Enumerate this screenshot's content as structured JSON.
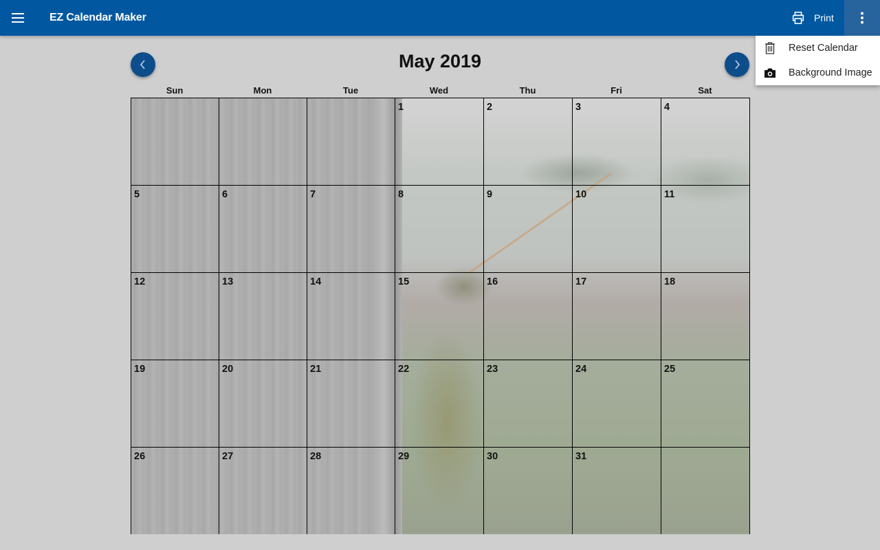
{
  "app": {
    "title": "EZ Calendar Maker",
    "icons": {
      "menu": "hamburger-menu-icon",
      "print": "printer-icon",
      "more": "more-vert-icon"
    },
    "brand_color": "#0158a1"
  },
  "toolbar": {
    "print_label": "Print"
  },
  "overflow_menu": {
    "items": [
      {
        "label": "Reset Calendar",
        "icon": "trash-icon"
      },
      {
        "label": "Background Image",
        "icon": "camera-icon"
      }
    ]
  },
  "calendar": {
    "title": "May 2019",
    "prev_icon": "chevron-left-icon",
    "next_icon": "chevron-right-icon",
    "weekdays": [
      "Sun",
      "Mon",
      "Tue",
      "Wed",
      "Thu",
      "Fri",
      "Sat"
    ],
    "weeks": [
      [
        "",
        "",
        "",
        "1",
        "2",
        "3",
        "4"
      ],
      [
        "5",
        "6",
        "7",
        "8",
        "9",
        "10",
        "11"
      ],
      [
        "12",
        "13",
        "14",
        "15",
        "16",
        "17",
        "18"
      ],
      [
        "19",
        "20",
        "21",
        "22",
        "23",
        "24",
        "25"
      ],
      [
        "26",
        "27",
        "28",
        "29",
        "30",
        "31",
        ""
      ]
    ],
    "background_image": "grasshopper-on-fence-photo"
  }
}
